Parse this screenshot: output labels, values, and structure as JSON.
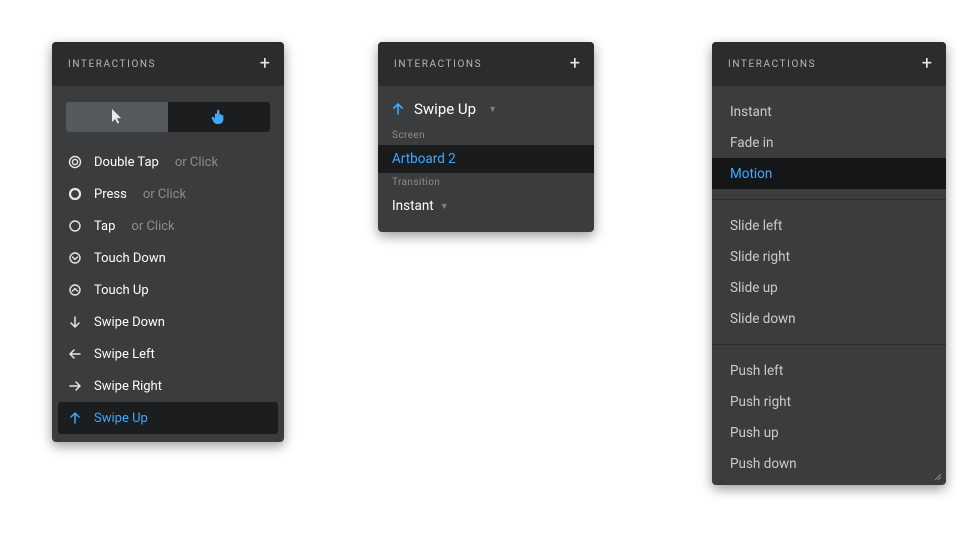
{
  "colors": {
    "accent": "#3ea9ff",
    "panel": "#3a3c3d",
    "panel_dark": "#2a2c2d",
    "sel_bg": "#151617"
  },
  "panel1": {
    "title": "INTERACTIONS",
    "toggle": {
      "cursor_active": true
    },
    "triggers": [
      {
        "icon": "double-tap-icon",
        "label": "Double Tap",
        "suffix": "or Click",
        "selected": false
      },
      {
        "icon": "press-icon",
        "label": "Press",
        "suffix": "or Click",
        "selected": false
      },
      {
        "icon": "tap-icon",
        "label": "Tap",
        "suffix": "or Click",
        "selected": false
      },
      {
        "icon": "touch-down-icon",
        "label": "Touch Down",
        "suffix": "",
        "selected": false
      },
      {
        "icon": "touch-up-icon",
        "label": "Touch Up",
        "suffix": "",
        "selected": false
      },
      {
        "icon": "swipe-down-icon",
        "label": "Swipe Down",
        "suffix": "",
        "selected": false
      },
      {
        "icon": "swipe-left-icon",
        "label": "Swipe Left",
        "suffix": "",
        "selected": false
      },
      {
        "icon": "swipe-right-icon",
        "label": "Swipe Right",
        "suffix": "",
        "selected": false
      },
      {
        "icon": "swipe-up-icon",
        "label": "Swipe Up",
        "suffix": "",
        "selected": true
      }
    ]
  },
  "panel2": {
    "title": "INTERACTIONS",
    "trigger_label": "Swipe Up",
    "fields": {
      "screen_label": "Screen",
      "screen_value": "Artboard 2",
      "transition_label": "Transition",
      "transition_value": "Instant"
    }
  },
  "panel3": {
    "title": "INTERACTIONS",
    "groups": [
      [
        {
          "label": "Instant",
          "selected": false
        },
        {
          "label": "Fade in",
          "selected": false
        },
        {
          "label": "Motion",
          "selected": true
        }
      ],
      [
        {
          "label": "Slide left",
          "selected": false
        },
        {
          "label": "Slide right",
          "selected": false
        },
        {
          "label": "Slide up",
          "selected": false
        },
        {
          "label": "Slide down",
          "selected": false
        }
      ],
      [
        {
          "label": "Push left",
          "selected": false
        },
        {
          "label": "Push right",
          "selected": false
        },
        {
          "label": "Push up",
          "selected": false
        },
        {
          "label": "Push down",
          "selected": false
        }
      ]
    ]
  }
}
